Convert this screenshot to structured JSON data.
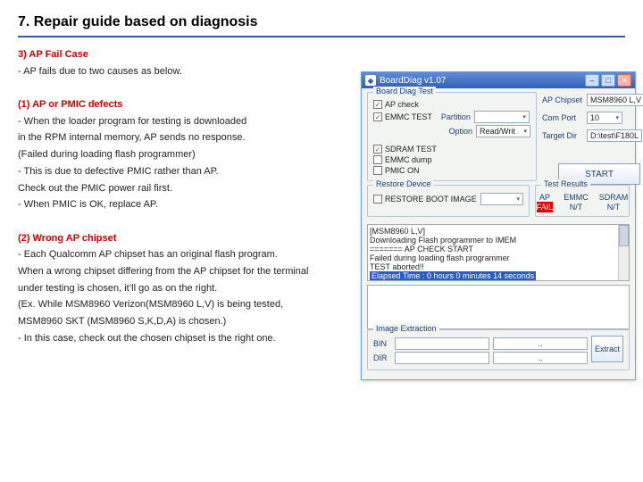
{
  "page": {
    "title": "7. Repair guide based on diagnosis"
  },
  "sec3": {
    "heading": "3) AP Fail Case",
    "intro": "-  AP fails due to two causes as below."
  },
  "s1": {
    "heading": "(1) AP or PMIC defects",
    "l1": "-  When the loader program for testing is downloaded",
    "l2": "in the RPM internal memory, AP sends no response.",
    "l3": "   (Failed during loading flash programmer)",
    "l4": "-  This is due to defective PMIC rather than AP.",
    "l5": "   Check out the PMIC power rail first.",
    "l6": "-  When PMIC is OK, replace AP."
  },
  "s2": {
    "heading": "(2) Wrong AP chipset",
    "l1": "-  Each Qualcomm AP chipset has an original flash program.",
    "l2": "   When a wrong chipset differing from the AP chipset for the terminal",
    "l3": "   under testing  is chosen, it’ll go as on the right.",
    "l4": "   (Ex. While MSM8960 Verizon(MSM8960 L,V) is being tested,",
    "l5": "    MSM8960 SKT (MSM8960 S,K,D,A) is chosen.)",
    "l6": "-  In this case, check out the chosen chipset is the right one."
  },
  "win": {
    "title": "BoardDiag v1.07",
    "diag": {
      "group": "Board Diag Test",
      "ap_check": "AP check",
      "emmc_test": "EMMC TEST",
      "partition_lbl": "Partition",
      "partition_val": "",
      "option_lbl": "Option",
      "option_val": "Read/Writ",
      "sdram": "SDRAM TEST",
      "emmc_dump": "EMMC dump",
      "pmic_on": "PMIC ON",
      "ap_chipset_lbl": "AP Chipset",
      "ap_chipset_val": "MSM8960 L,V",
      "com_lbl": "Com Port",
      "com_val": "10",
      "tgt_lbl": "Target Dir",
      "tgt_val": "D:\\test\\F180L",
      "start": "START"
    },
    "results": {
      "group": "Test Results",
      "ap": "AP",
      "ap_val": "FAIL",
      "emmc": "EMMC",
      "emmc_val": "N/T",
      "sdram": "SDRAM",
      "sdram_val": "N/T"
    },
    "restore": {
      "group": "Restore Device",
      "cb": "RESTORE BOOT IMAGE",
      "val": ""
    },
    "log": {
      "l1": "[MSM8960 L,V]",
      "l2": "Downloading Flash programmer to IMEM",
      "l3": "======= AP CHECK START",
      "l4": "Failed during loading flash programmer",
      "l5": "TEST aborted!!",
      "hl": "Elapsed Time : 0 hours 0 minutes 14 seconds"
    },
    "extract": {
      "group": "Image Extraction",
      "bin": "BIN",
      "bin_val": "",
      "dir": "DIR",
      "dir_val": "",
      "btn": "Extract"
    }
  }
}
